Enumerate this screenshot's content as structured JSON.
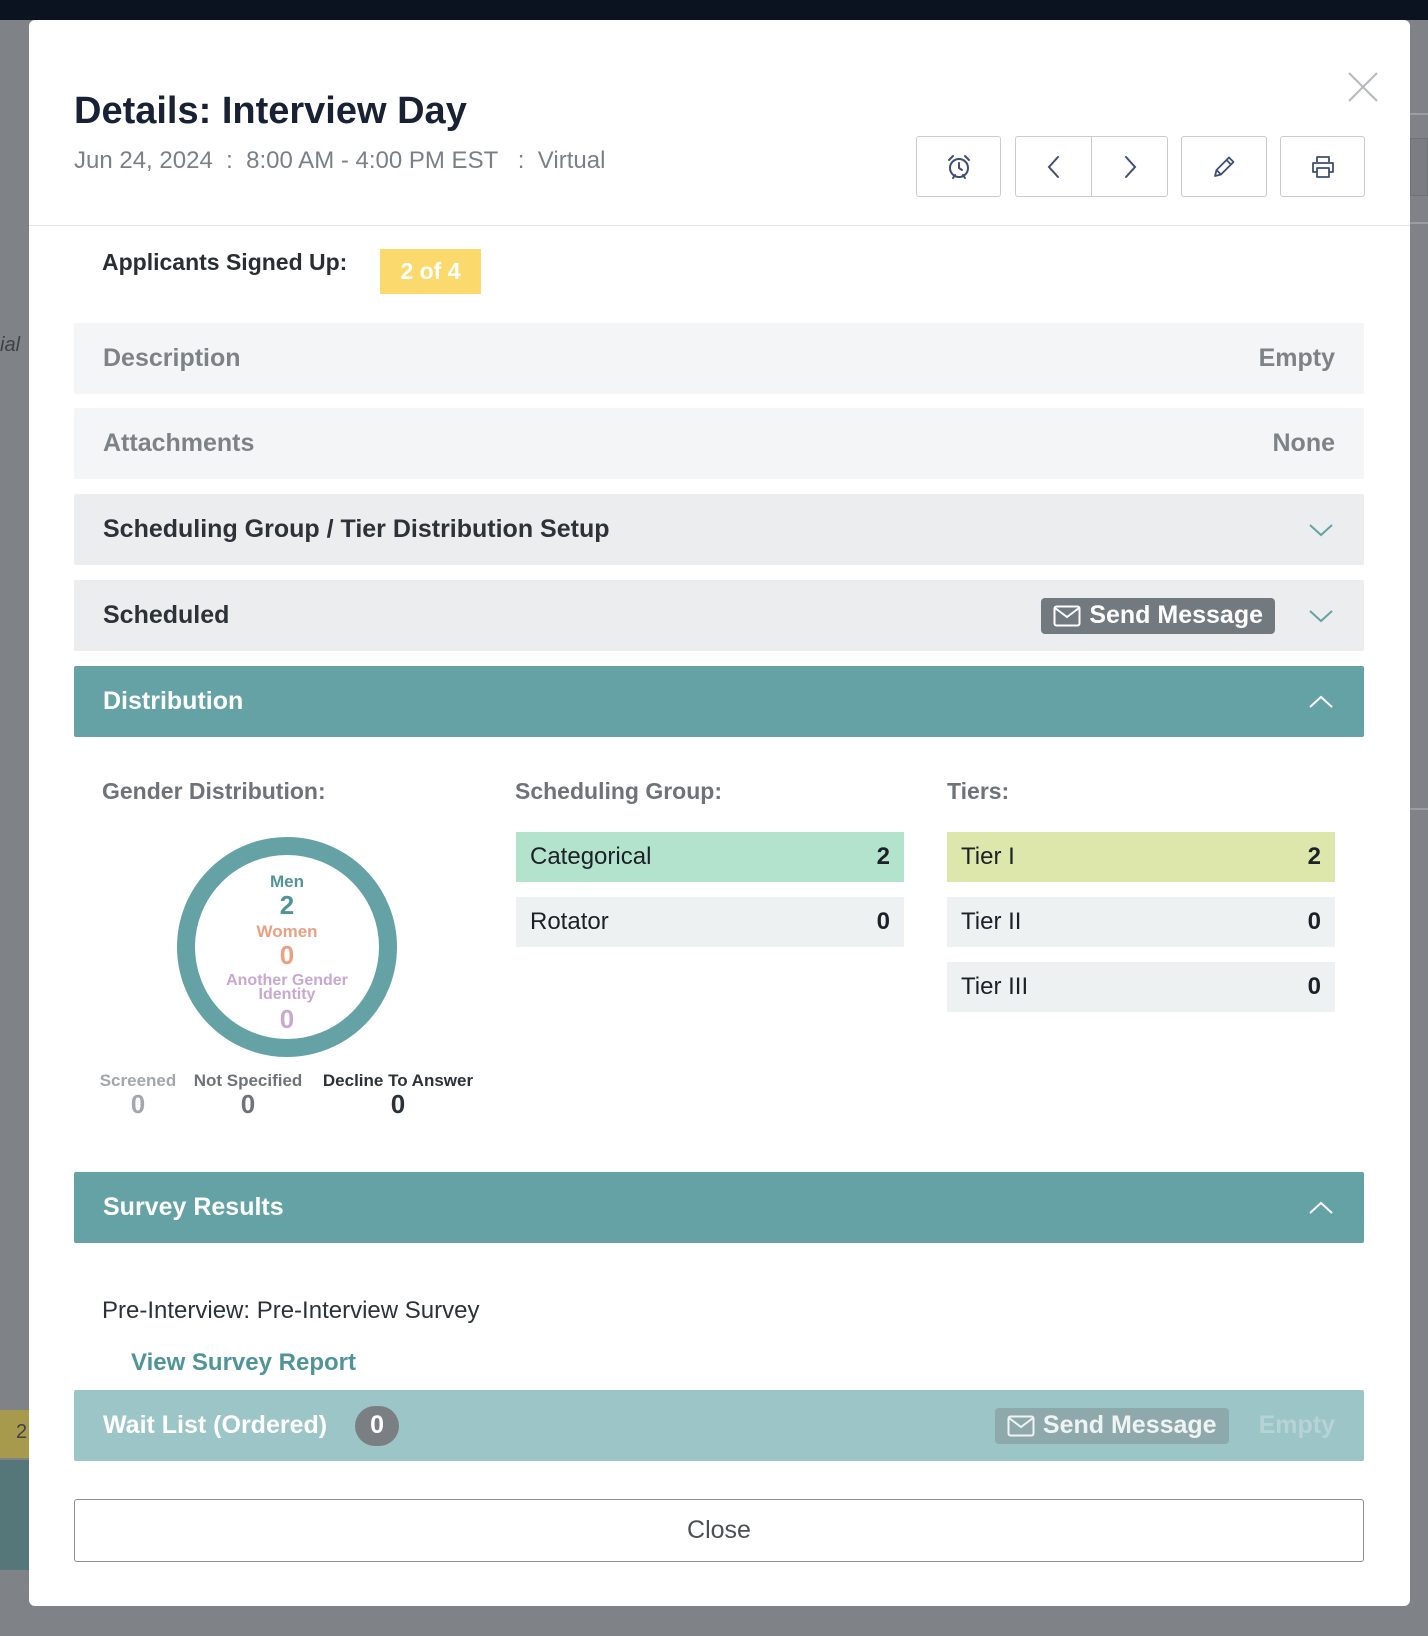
{
  "modal": {
    "title": "Details: Interview Day",
    "subtitle": "Jun 24, 2024  :  8:00 AM - 4:00 PM EST   :  Virtual"
  },
  "toolbar": {
    "icons": [
      "alarm-clock-icon",
      "chevron-left-icon",
      "chevron-right-icon",
      "pencil-icon",
      "printer-icon"
    ]
  },
  "background": {
    "partial_text": "ial",
    "partial_number": "2"
  },
  "applicants": {
    "label": "Applicants Signed Up:",
    "badge": "2 of 4"
  },
  "sections": {
    "description": {
      "label": "Description",
      "value": "Empty"
    },
    "attachments": {
      "label": "Attachments",
      "value": "None"
    },
    "scheduling_setup": {
      "label": "Scheduling Group / Tier Distribution Setup"
    },
    "scheduled": {
      "label": "Scheduled",
      "send_label": "Send Message"
    },
    "distribution": {
      "label": "Distribution"
    },
    "survey": {
      "label": "Survey Results"
    },
    "waitlist": {
      "label": "Wait List (Ordered)",
      "count": "0",
      "send_label": "Send Message",
      "value": "Empty"
    }
  },
  "distribution": {
    "gender_title": "Gender Distribution:",
    "scheduling_title": "Scheduling Group:",
    "tiers_title": "Tiers:",
    "donut": {
      "men_label": "Men",
      "men_value": "2",
      "women_label": "Women",
      "women_value": "0",
      "other_label_1": "Another Gender",
      "other_label_2": "Identity",
      "other_value": "0"
    },
    "stats": {
      "screened_label": "Screened",
      "screened_value": "0",
      "not_specified_label": "Not Specified",
      "not_specified_value": "0",
      "decline_label": "Decline To Answer",
      "decline_value": "0"
    },
    "scheduling_groups": [
      {
        "name": "Categorical",
        "count": "2"
      },
      {
        "name": "Rotator",
        "count": "0"
      }
    ],
    "tiers": [
      {
        "name": "Tier I",
        "count": "2"
      },
      {
        "name": "Tier II",
        "count": "0"
      },
      {
        "name": "Tier III",
        "count": "0"
      }
    ]
  },
  "survey": {
    "line": "Pre-Interview: Pre-Interview Survey",
    "link": "View Survey Report"
  },
  "footer": {
    "close_label": "Close"
  },
  "colors": {
    "teal": "#64a2a6",
    "badge_yellow": "#fbd96c",
    "categorical_green": "#b3e3cd",
    "tier1_yellow": "#dde6ab",
    "men": "#4f9499",
    "women": "#e8a183",
    "other_gender": "#c9a8cf"
  }
}
